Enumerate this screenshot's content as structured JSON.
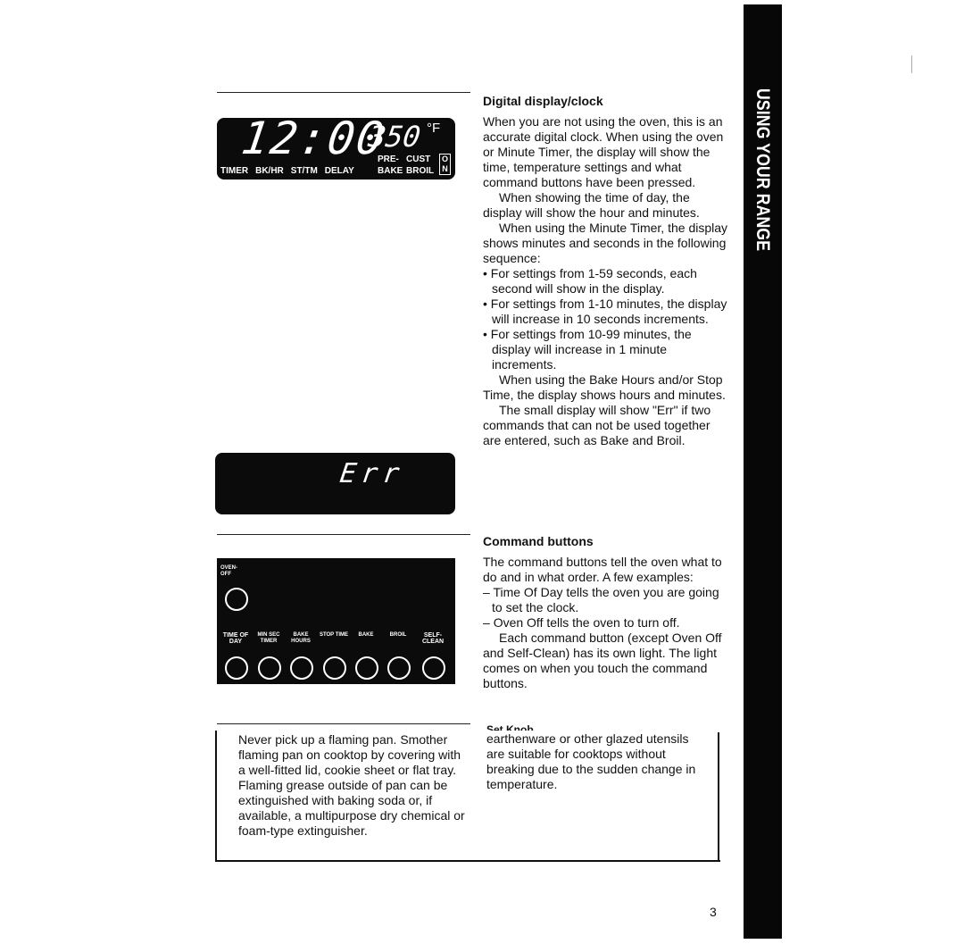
{
  "clock_display": {
    "time": "12:00",
    "temp": "350",
    "unit": "°F",
    "labels": [
      "TIMER",
      "BK/HR",
      "ST/TM",
      "DELAY"
    ],
    "pre_bake": [
      "PRE-",
      "BAKE"
    ],
    "cust_broil": [
      "CUST",
      "BROIL"
    ],
    "on": "ON"
  },
  "err_display": {
    "text": "Err"
  },
  "buttons_panel": {
    "oven_off": "OVEN- OFF",
    "buttons": [
      "TIME OF DAY",
      "MIN SEC TIMER",
      "BAKE HOURS",
      "STOP TIME",
      "BAKE",
      "BROIL",
      "SELF- CLEAN"
    ]
  },
  "section_digital": {
    "heading": "Digital display/clock",
    "p1": "When you are not using the oven, this is an accurate digital clock. When using the oven or Minute Timer, the display will show the time, temperature settings and what command buttons have been pressed.",
    "p2": "When showing the time of day, the display will show the hour and minutes.",
    "p3": "When using the Minute Timer, the display shows minutes and seconds in the following sequence:",
    "bullets": [
      "For settings from 1-59 seconds, each second will show in the display.",
      "For settings from 1-10 minutes, the display will increase in 10 seconds increments.",
      "For settings from 10-99 minutes, the display will increase in 1 minute increments."
    ],
    "p4": "When using the Bake Hours and/or Stop Time, the display shows hours and minutes.",
    "p5": "The small display will show \"Err\" if two commands that can not be used together are entered, such as Bake and Broil."
  },
  "section_command": {
    "heading": "Command buttons",
    "p1": "The command buttons tell the oven what to do and in what order. A few examples:",
    "dashes": [
      "Time Of Day tells the oven you are going to set the clock.",
      "Oven Off tells the oven to turn off."
    ],
    "p2": "Each command button (except Oven Off and Self-Clean) has its own light. The light comes on when you touch the command buttons."
  },
  "set_knob_heading": "Set Knob",
  "warning_left": "Never pick up a flaming pan. Smother flaming pan on cooktop by covering with a well-fitted lid, cookie sheet or flat tray. Flaming grease outside of pan can be extinguished with baking soda or, if available, a multipurpose dry chemical or foam-type extinguisher.",
  "warning_right": "earthenware or other glazed utensils are suitable for cooktops without breaking due to the sudden change in temperature.",
  "side_tab": "USING YOUR RANGE",
  "page_number": "3"
}
